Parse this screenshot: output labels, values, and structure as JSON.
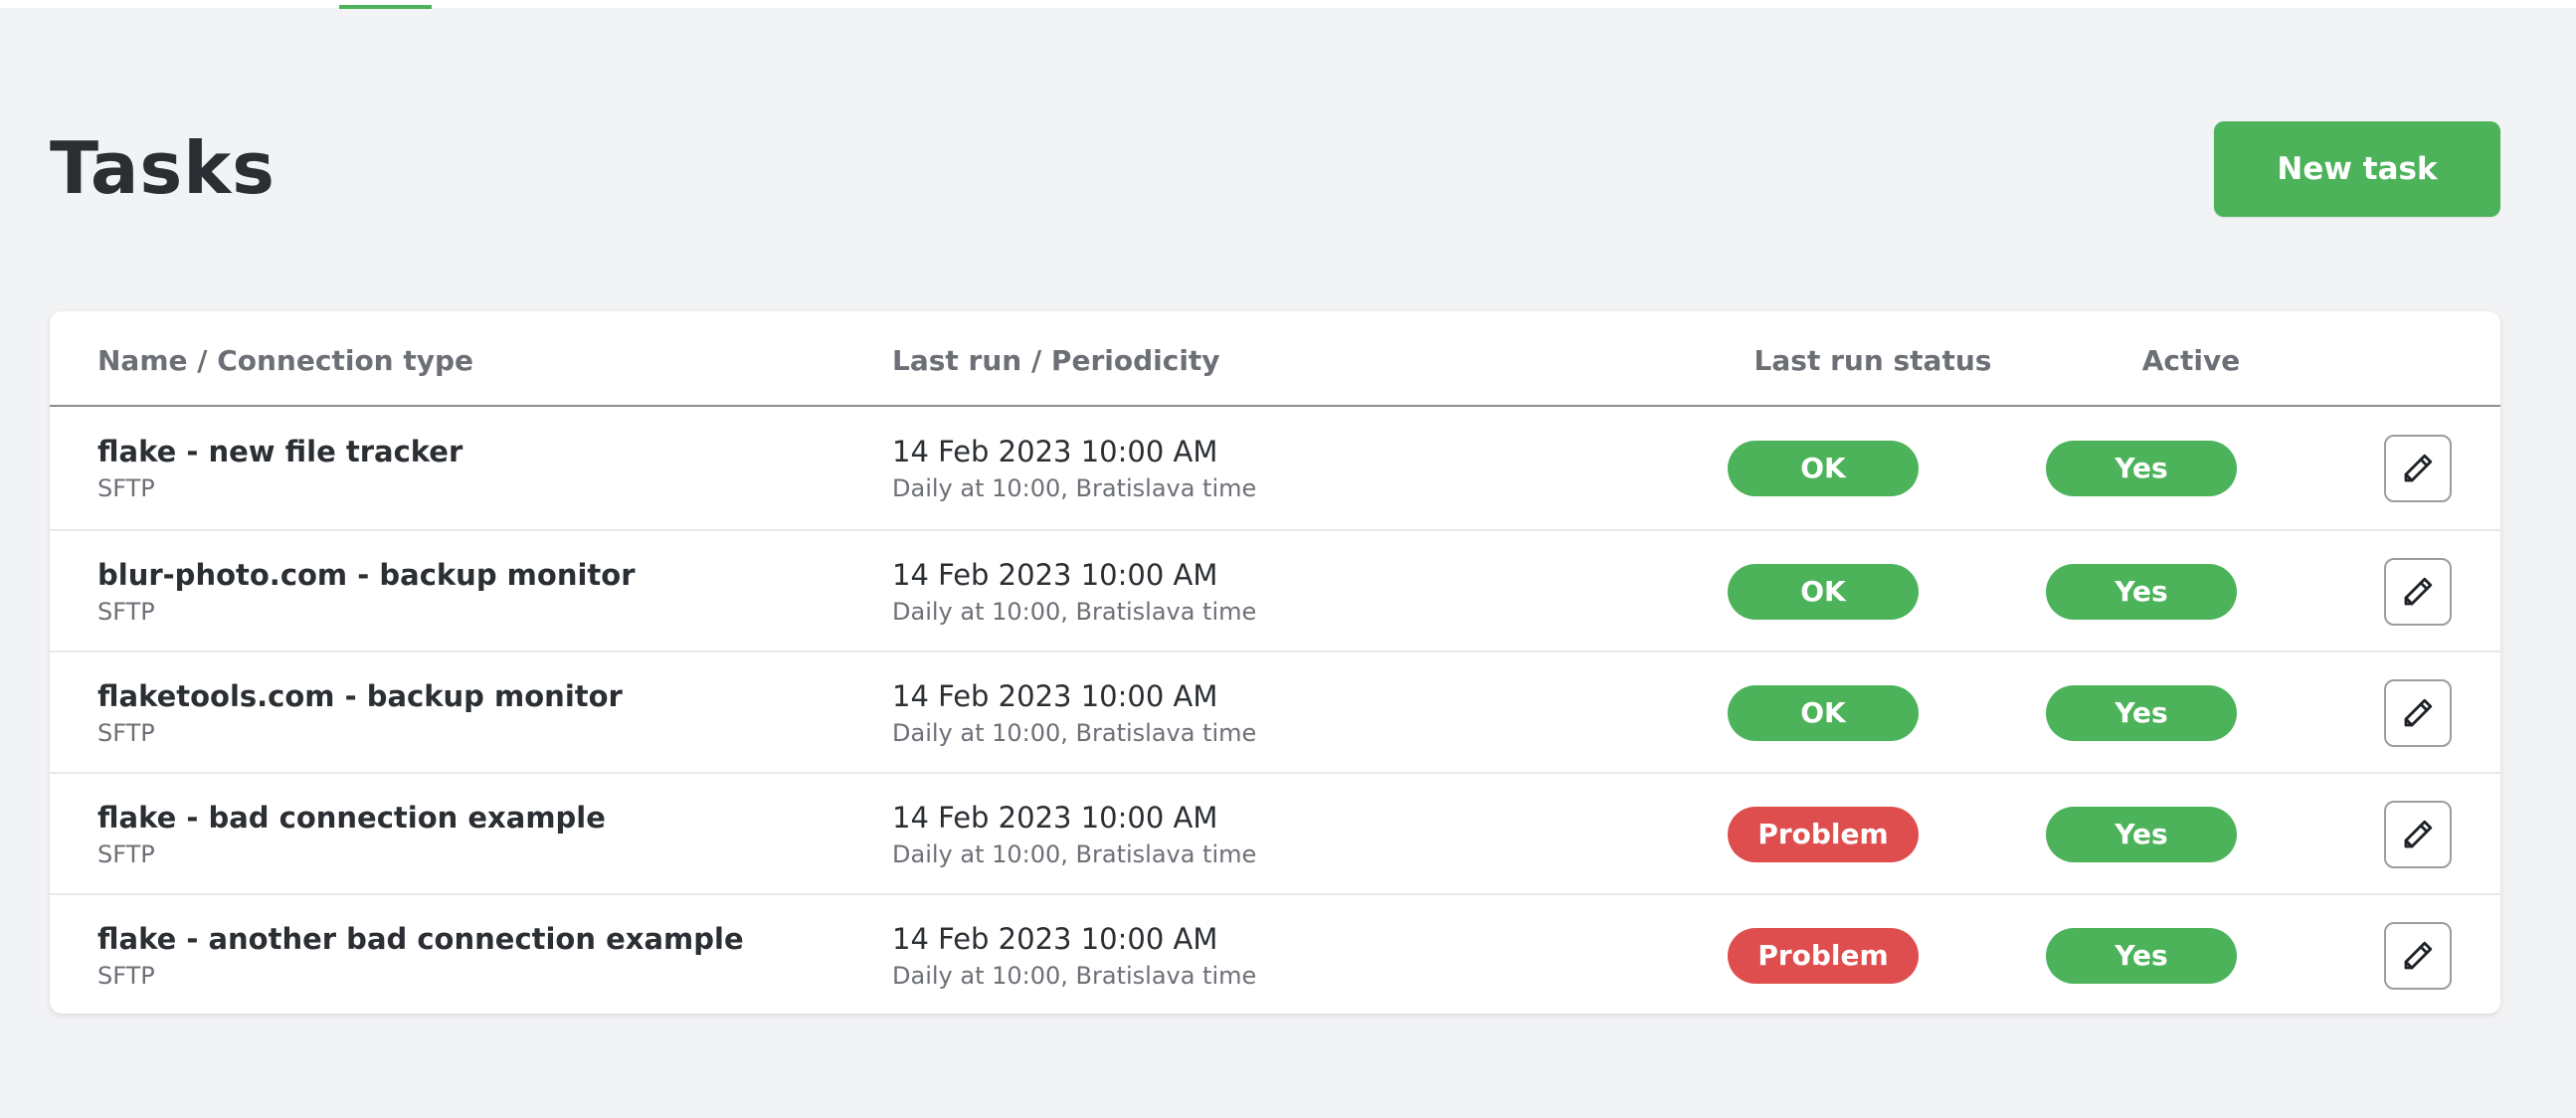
{
  "header": {
    "title": "Tasks",
    "new_task_label": "New task"
  },
  "table": {
    "columns": {
      "name": "Name / Connection type",
      "last_run": "Last run / Periodicity",
      "status": "Last run status",
      "active": "Active"
    },
    "rows": [
      {
        "name": "flake - new file tracker",
        "connection_type": "SFTP",
        "last_run": "14 Feb 2023 10:00 AM",
        "periodicity": "Daily at 10:00, Bratislava time",
        "status": "OK",
        "status_kind": "ok",
        "active": "Yes"
      },
      {
        "name": "blur-photo.com - backup monitor",
        "connection_type": "SFTP",
        "last_run": "14 Feb 2023 10:00 AM",
        "periodicity": "Daily at 10:00, Bratislava time",
        "status": "OK",
        "status_kind": "ok",
        "active": "Yes"
      },
      {
        "name": "flaketools.com - backup monitor",
        "connection_type": "SFTP",
        "last_run": "14 Feb 2023 10:00 AM",
        "periodicity": "Daily at 10:00, Bratislava time",
        "status": "OK",
        "status_kind": "ok",
        "active": "Yes"
      },
      {
        "name": "flake - bad connection example",
        "connection_type": "SFTP",
        "last_run": "14 Feb 2023 10:00 AM",
        "periodicity": "Daily at 10:00, Bratislava time",
        "status": "Problem",
        "status_kind": "problem",
        "active": "Yes"
      },
      {
        "name": "flake - another bad connection example",
        "connection_type": "SFTP",
        "last_run": "14 Feb 2023 10:00 AM",
        "periodicity": "Daily at 10:00, Bratislava time",
        "status": "Problem",
        "status_kind": "problem",
        "active": "Yes"
      }
    ]
  },
  "icons": {
    "edit": "pencil-icon"
  },
  "colors": {
    "accent": "#4db35a",
    "problem": "#df4e4e",
    "background": "#f2f3f5",
    "text": "#2b2f33",
    "muted": "#6c7076"
  }
}
